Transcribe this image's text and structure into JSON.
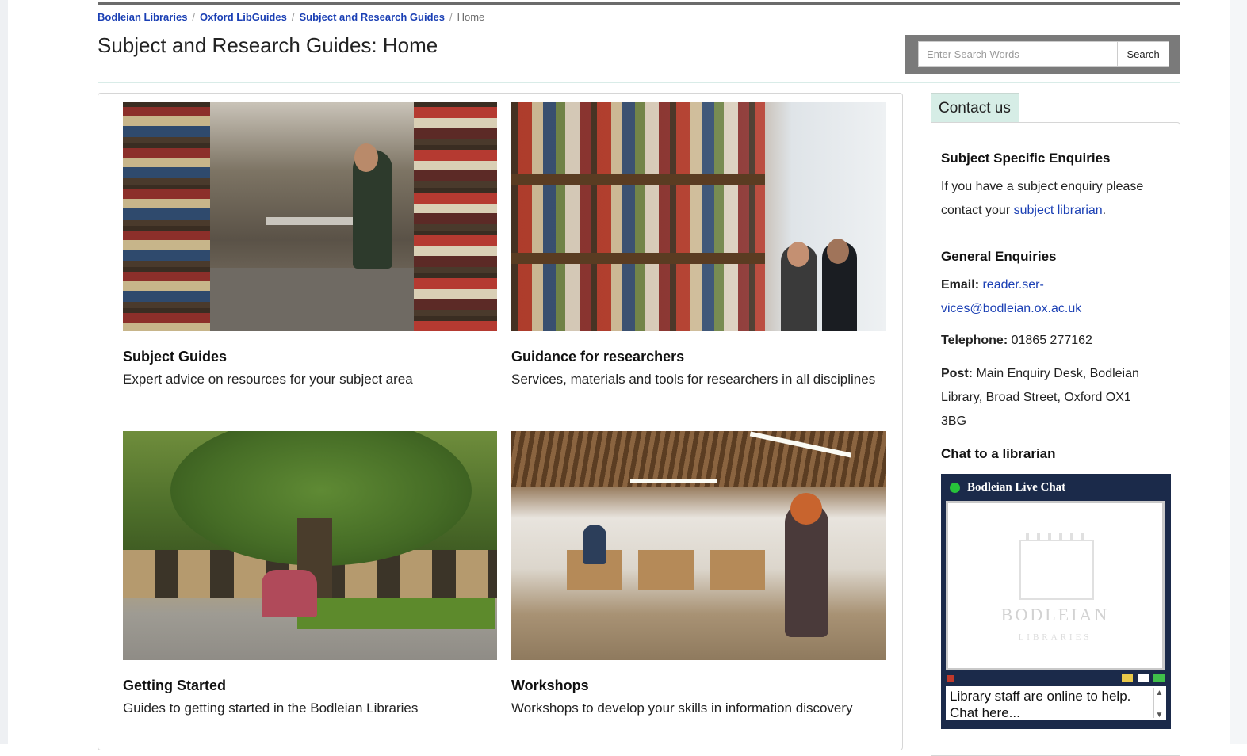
{
  "breadcrumb": {
    "items": [
      "Bodleian Libraries",
      "Oxford LibGuides",
      "Subject and Research Guides"
    ],
    "current": "Home",
    "separator": "/"
  },
  "page_title": "Subject and Research Guides: Home",
  "search": {
    "placeholder": "Enter Search Words",
    "button_label": "Search"
  },
  "cards": [
    {
      "title": "Subject Guides",
      "description": "Expert advice on resources for your subject area",
      "image": "library-stacks-photo"
    },
    {
      "title": "Guidance for researchers",
      "description": "Services, materials and tools for researchers in all disciplines",
      "image": "bookshelf-photo"
    },
    {
      "title": "Getting Started",
      "description": "Guides to getting started in the Bodleian Libraries",
      "image": "courtyard-tree-photo"
    },
    {
      "title": "Workshops",
      "description": "Workshops to develop your skills in information discovery",
      "image": "workshop-room-photo"
    }
  ],
  "sidebar": {
    "tab_label": "Contact us",
    "subject_heading": "Subject Specific Enquiries",
    "subject_text_1": "If you have a subject enquiry please",
    "subject_text_2": "contact your",
    "subject_link": "subject librarian",
    "subject_text_end": ".",
    "general_heading": "General Enquiries",
    "email_label": "Email:",
    "email_line_1": "reader.ser-",
    "email_line_2": "vices@bodleian.ox.ac.uk",
    "telephone_label": "Telephone:",
    "telephone_value": "01865 277162",
    "post_label": "Post:",
    "post_line_1": "Main Enquiry Desk, Bodleian",
    "post_line_2": "Library, Broad Street, Oxford OX1",
    "post_line_3": "3BG",
    "chat_heading": "Chat to a librarian"
  },
  "chat": {
    "title": "Bodleian Live Chat",
    "logo_main": "BODLEIAN",
    "logo_sub": "LIBRARIES",
    "message": "Library staff are online to help. Chat here..."
  },
  "colors": {
    "link": "#1a3fb4",
    "chat_bg": "#1b2a4a",
    "tab_bg": "#d6ede6",
    "status_online": "#27c23a"
  }
}
